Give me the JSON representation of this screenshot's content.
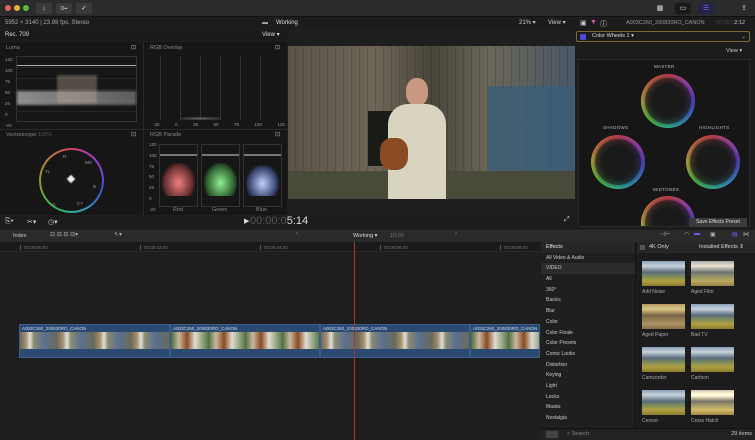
{
  "toolbar": {
    "import_icon": "download-icon",
    "keyword_icon": "key-icon",
    "check_icon": "checkmark-circle-icon",
    "share_icon": "share-icon"
  },
  "browser": {
    "info": "5952 × 3140 | 23.98 fps, Stereo"
  },
  "viewer": {
    "library": "Working",
    "zoom": "21%",
    "view": "View",
    "timecode_dim": "00:00:0",
    "timecode": "5:14"
  },
  "scopes": {
    "colorspace": "Rec. 709",
    "view": "View",
    "luma": {
      "title": "Luma",
      "ticks": [
        "120",
        "100",
        "75",
        "50",
        "25",
        "0",
        "-20"
      ]
    },
    "rgb_overlay": {
      "title": "RGB Overlay",
      "ticks": [
        "-25",
        "0",
        "25",
        "50",
        "75",
        "100",
        "125"
      ]
    },
    "vectorscope": {
      "title": "Vectorscope",
      "pct": "100%",
      "labels": [
        "R",
        "MG",
        "B",
        "CY",
        "G",
        "YL"
      ]
    },
    "rgb_parade": {
      "title": "RGB Parade",
      "ticks": [
        "120",
        "100",
        "75",
        "50",
        "25",
        "0",
        "-20"
      ],
      "channels": [
        "Red",
        "Green",
        "Blue"
      ]
    }
  },
  "inspector": {
    "clip_name": "A003C260_200830RO_CANON",
    "duration_dim": "00:00:0",
    "duration": "2:12",
    "effect": "Color Wheels 1",
    "effect_enabled": true,
    "view": "View",
    "wheels": [
      "MASTER",
      "SHADOWS",
      "HIGHLIGHTS",
      "MIDTONES"
    ],
    "save_preset": "Save Effects Preset"
  },
  "timeline": {
    "index": "Index",
    "project": "Working",
    "duration": "10:00",
    "ruler": [
      "00:00:00:00",
      "00:00:02:00",
      "00:00:04:00",
      "00:00:06:00",
      "00:00:08:00"
    ],
    "clips": [
      "A003C260_200830RO_CANON",
      "A003C260_200830RO_CANON",
      "A003C260_200830RO_CANON",
      "A003C260_200830RO_CANON"
    ]
  },
  "effects": {
    "title": "Effects",
    "four_k_only": "4K Only",
    "installed": "Installed Effects",
    "categories": [
      "All Video & Audio",
      "VIDEO",
      "All",
      "360°",
      "Basics",
      "Blur",
      "Color",
      "Color Finale",
      "Color Presets",
      "Comic Looks",
      "Distortion",
      "Keying",
      "Light",
      "Looks",
      "Masks",
      "Nostalgia"
    ],
    "selected_category": "VIDEO",
    "items": [
      "Add Noise",
      "Aged Film",
      "Aged Paper",
      "Bad TV",
      "Camcorder",
      "Cartoon",
      "Censor",
      "Cross Hatch"
    ],
    "search_placeholder": "Search",
    "count": "29 items"
  }
}
